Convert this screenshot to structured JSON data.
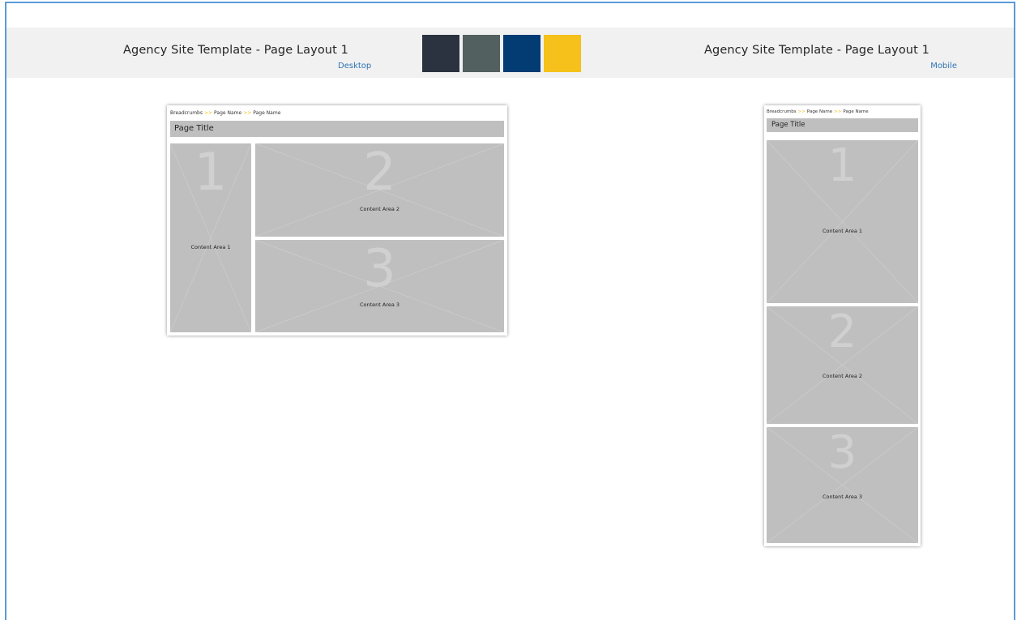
{
  "header": {
    "desktop_title": "Agency Site Template - Page Layout 1",
    "desktop_subtitle": "Desktop",
    "mobile_title": "Agency Site Template  - Page Layout 1",
    "mobile_subtitle": "Mobile"
  },
  "palette": [
    "#2b3240",
    "#52605f",
    "#033b73",
    "#f5c11a"
  ],
  "wireframe": {
    "breadcrumb": [
      "Breadcrumbs",
      "Page Name",
      "Page Name"
    ],
    "breadcrumb_separator": ">>",
    "page_title": "Page Title",
    "areas": [
      {
        "number": "1",
        "label": "Content Area 1"
      },
      {
        "number": "2",
        "label": "Content Area 2"
      },
      {
        "number": "3",
        "label": "Content Area 3"
      }
    ]
  }
}
